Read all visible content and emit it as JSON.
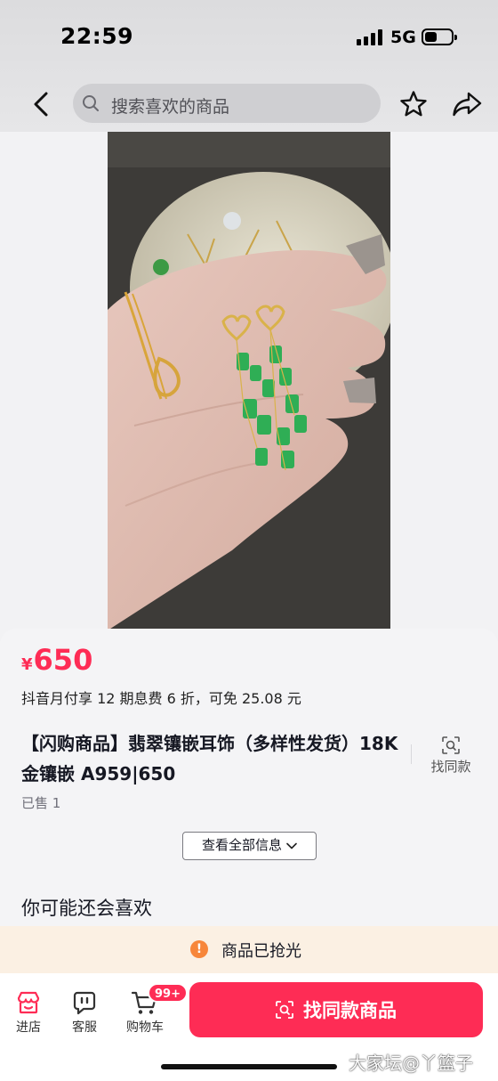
{
  "status_bar": {
    "time": "22:59",
    "network": "5G"
  },
  "nav": {
    "search_placeholder": "搜索喜欢的商品"
  },
  "product": {
    "price_currency": "¥",
    "price": "650",
    "installment_note": "抖音月付享 12 期息费 6 折，可免 25.08 元",
    "title": "【闪购商品】翡翠镶嵌耳饰（多样性发货）18K金镶嵌 A959|650",
    "find_similar_label": "找同款",
    "sold": "已售 1",
    "view_all_label": "查看全部信息"
  },
  "recommend_title": "你可能还会喜欢",
  "soldout_notice": {
    "icon": "!",
    "text": "商品已抢光"
  },
  "bottom_bar": {
    "tabs": [
      {
        "label": "进店",
        "icon": "store-icon"
      },
      {
        "label": "客服",
        "icon": "chat-icon"
      },
      {
        "label": "购物车",
        "icon": "cart-icon"
      }
    ],
    "cart_badge": "99+",
    "cta_label": "找同款商品"
  },
  "watermark": "大家坛@丫篮子",
  "colors": {
    "accent": "#fe2c55",
    "notice_bg": "#fbf0e3",
    "warn": "#f7863a"
  }
}
